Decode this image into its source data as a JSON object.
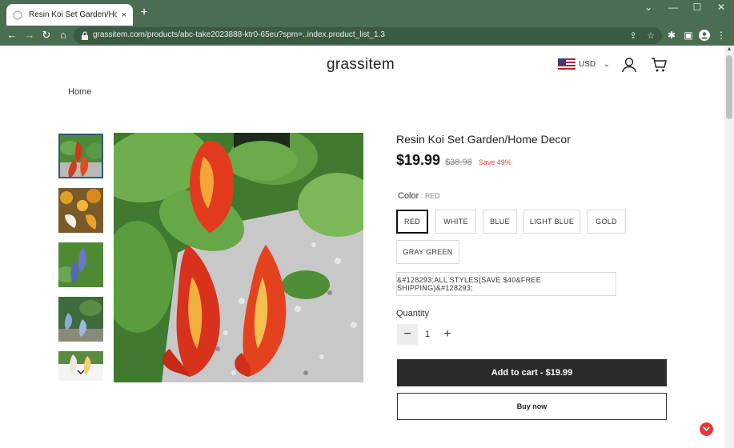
{
  "browser": {
    "tab_title": "Resin Koi Set Garden/Home Dec",
    "tab_close": "×",
    "new_tab": "+",
    "controls": {
      "minimize": "⌄",
      "min": "—",
      "max": "☐",
      "close": "✕"
    },
    "url": "grassitem.com/products/abc-take2023888-ktr0-65eu?spm=..index.product_list_1.3"
  },
  "header": {
    "logo": "grassitem",
    "currency": "USD"
  },
  "breadcrumb": {
    "home": "Home"
  },
  "product": {
    "title": "Resin Koi Set Garden/Home Decor",
    "price": "$19.99",
    "old_price": "$38.98",
    "save": "Save 49%",
    "color_label": "Color",
    "color_sep": " : ",
    "color_value": "RED",
    "color_options": [
      "RED",
      "WHITE",
      "BLUE",
      "LIGHT BLUE",
      "GOLD",
      "GRAY GREEN"
    ],
    "bundle_option": "&#128293;ALL STYLES(SAVE $40&FREE SHIPPING)&#128293;",
    "quantity_label": "Quantity",
    "quantity": "1",
    "minus": "−",
    "plus": "+",
    "add_to_cart": "Add to cart",
    "add_sep": " - ",
    "add_price": "$19.99",
    "buy_now": "Buy now"
  },
  "colors": {
    "chrome": "#4b6e53",
    "accent": "#2b2b2b",
    "sale": "#e0503a"
  }
}
